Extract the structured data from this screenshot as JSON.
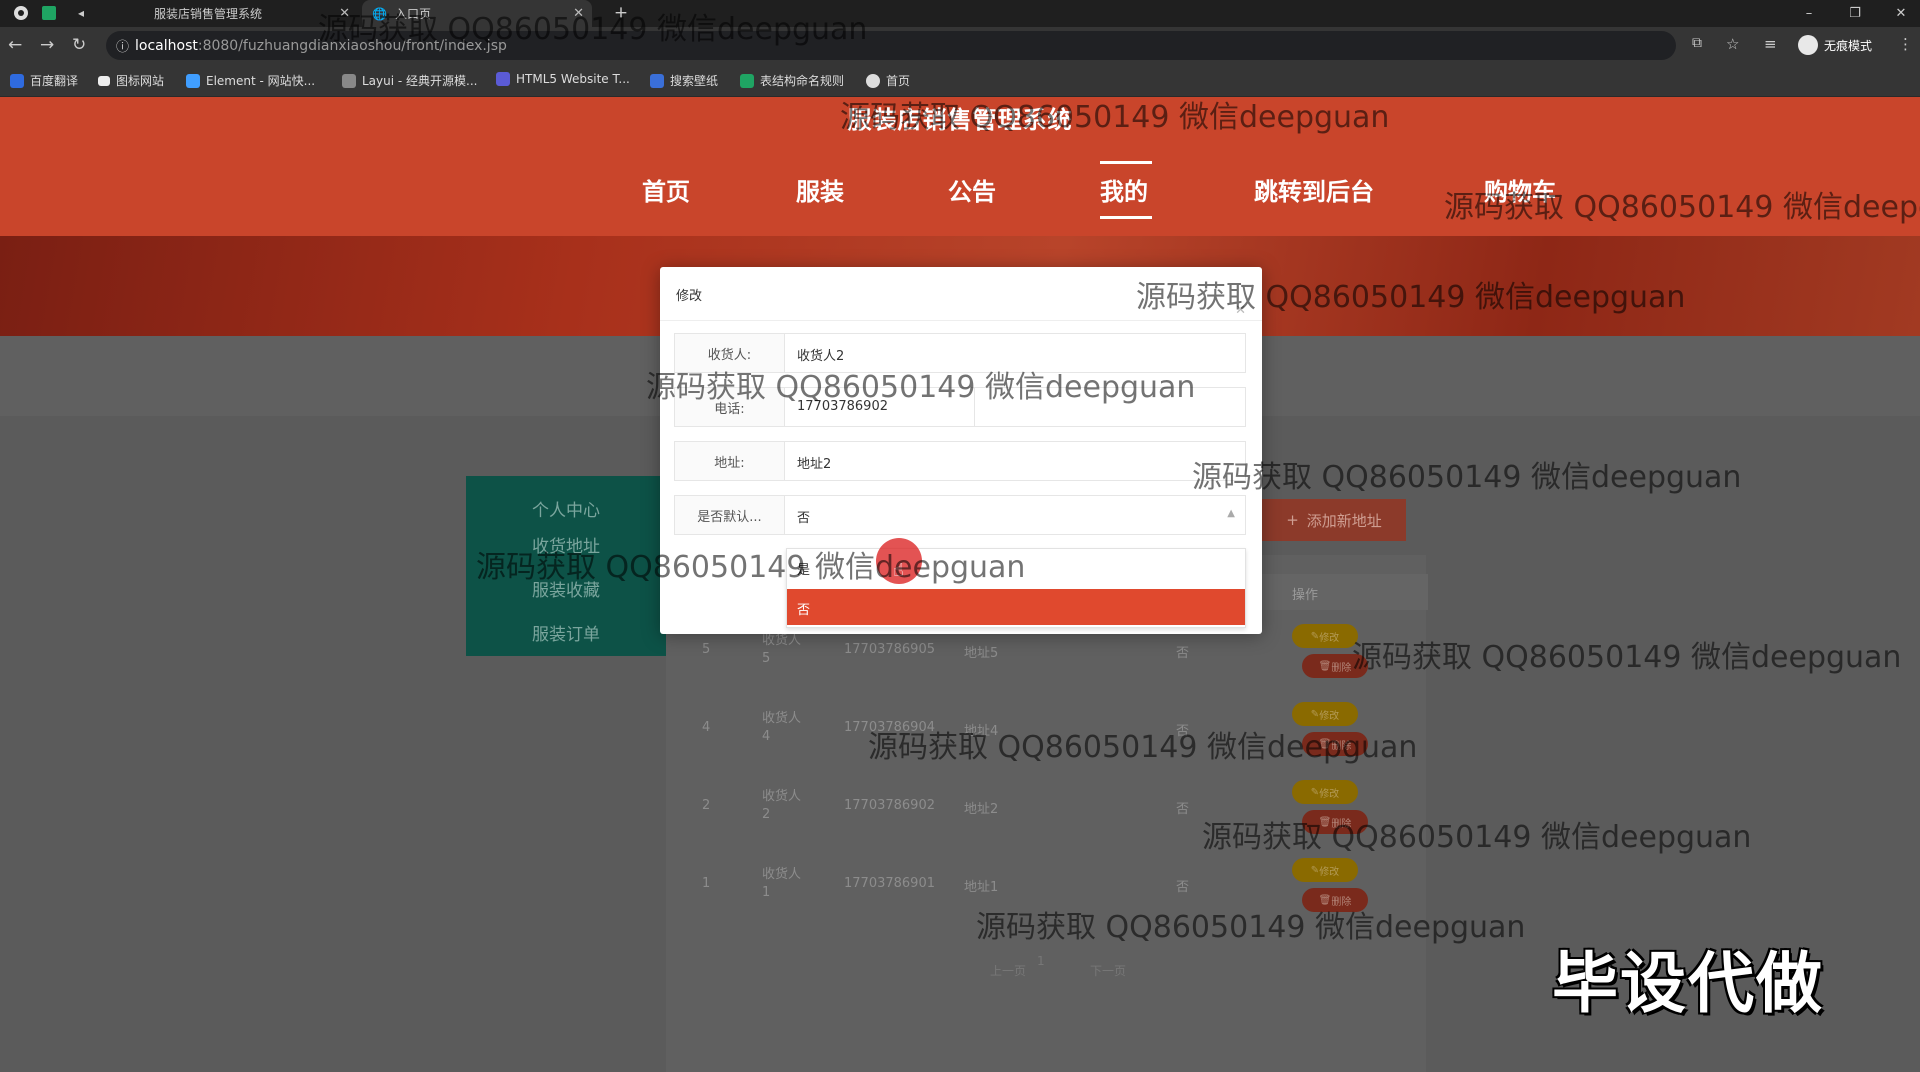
{
  "browser": {
    "tabs": [
      {
        "title": "服装店销售管理系统"
      },
      {
        "title": "入口页"
      }
    ],
    "url_host": "localhost",
    "url_path": ":8080/fuzhuangdianxiaoshou/front/index.jsp",
    "incognito_label": "无痕模式",
    "bookmarks": [
      "百度翻译",
      "图标网站",
      "Element - 网站快...",
      "Layui - 经典开源模...",
      "HTML5 Website T...",
      "搜索壁纸",
      "表结构命名规则",
      "首页"
    ]
  },
  "site": {
    "title": "服装店销售管理系统",
    "nav": [
      "首页",
      "服装",
      "公告",
      "我的",
      "跳转到后台",
      "购物车"
    ],
    "active_nav": "我的"
  },
  "sidebar": {
    "items": [
      "个人中心",
      "收货地址",
      "服装收藏",
      "服装订单"
    ]
  },
  "toolbar": {
    "add_label": "添加新地址"
  },
  "table": {
    "op_header": "操作",
    "rows": [
      {
        "id": "5",
        "name": "收货人\n5",
        "phone": "17703786905",
        "address": "地址5",
        "default": "否"
      },
      {
        "id": "4",
        "name": "收货人\n4",
        "phone": "17703786904",
        "address": "地址4",
        "default": "否"
      },
      {
        "id": "2",
        "name": "收货人\n2",
        "phone": "17703786902",
        "address": "地址2",
        "default": "否"
      },
      {
        "id": "1",
        "name": "收货人\n1",
        "phone": "17703786901",
        "address": "地址1",
        "default": "否"
      }
    ],
    "edit_label": "修改",
    "delete_label": "删除"
  },
  "pager": {
    "prev": "上一页",
    "current": "1",
    "next": "下一页"
  },
  "modal": {
    "title": "修改",
    "fields": [
      {
        "label": "收货人:",
        "value": "收货人2"
      },
      {
        "label": "电话:",
        "value": "17703786902"
      },
      {
        "label": "地址:",
        "value": "地址2"
      },
      {
        "label": "是否默认...",
        "value": "否"
      }
    ],
    "dropdown_options": [
      "是",
      "否"
    ],
    "dropdown_selected": "否"
  },
  "watermark": "源码获取 QQ86050149 微信deepguan",
  "stamp": "毕设代做"
}
